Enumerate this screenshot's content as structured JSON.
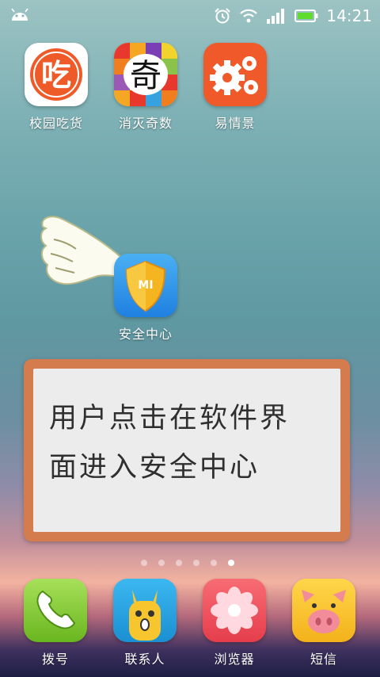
{
  "statusbar": {
    "time": "14:21",
    "icons": [
      "android-icon",
      "alarm-icon",
      "wifi-icon",
      "signal-icon",
      "battery-icon"
    ]
  },
  "apps": {
    "campus_food": {
      "label": "校园吃货",
      "icon": "campus-food-icon",
      "glyph": "吃"
    },
    "eliminate_odd": {
      "label": "消灭奇数",
      "icon": "eliminate-odd-icon",
      "glyph": "奇"
    },
    "easy_scene": {
      "label": "易情景",
      "icon": "easy-scene-gear-icon"
    },
    "security_center": {
      "label": "安全中心",
      "icon": "security-center-shield-icon",
      "badge": "MI"
    }
  },
  "instruction": {
    "text_line1": "用户点击在软件界",
    "text_line2": "面进入安全中心"
  },
  "page_indicator": {
    "count": 6,
    "active": 5
  },
  "dock": {
    "dialer": {
      "label": "拨号",
      "icon": "phone-icon"
    },
    "contacts": {
      "label": "联系人",
      "icon": "contacts-icon"
    },
    "browser": {
      "label": "浏览器",
      "icon": "browser-flower-icon"
    },
    "messages": {
      "label": "短信",
      "icon": "messages-pig-icon"
    }
  },
  "colors": {
    "instruction_frame": "#d57c4e",
    "instruction_inner": "#ececec",
    "campus_food_bg": "#ffffff",
    "easy_scene_bg": "#f05a2a",
    "security_bg": "#1f8be6",
    "dialer_bg": "#7ec92d",
    "contacts_bg": "#1aa4e0",
    "browser_bg": "#ef4e59",
    "messages_bg": "#f7c62f"
  }
}
